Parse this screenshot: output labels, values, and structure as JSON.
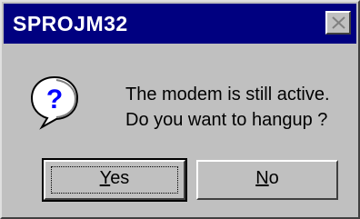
{
  "window": {
    "title": "SPROJM32",
    "close_icon": "close-x-icon"
  },
  "icon": {
    "name": "question-icon",
    "glyph": "?",
    "bubble_color": "#ffffff",
    "glyph_color": "#0000ff"
  },
  "message": {
    "line1": "The modem is still active.",
    "line2": "Do you want to hangup ?"
  },
  "buttons": {
    "yes": {
      "mnemonic": "Y",
      "rest": "es"
    },
    "no": {
      "mnemonic": "N",
      "rest": "o"
    }
  },
  "colors": {
    "titlebar": "#000080",
    "face": "#c0c0c0"
  }
}
